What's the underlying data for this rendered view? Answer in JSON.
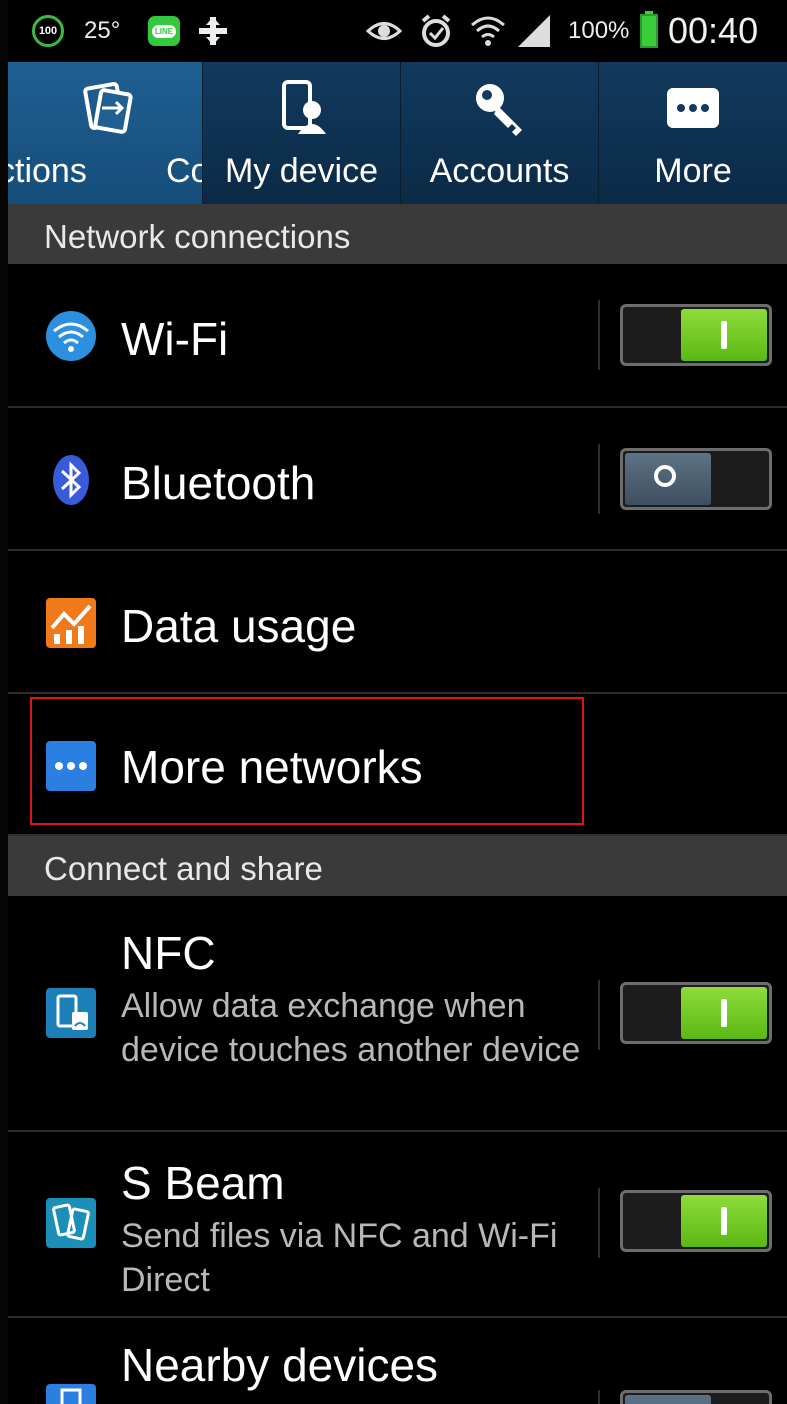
{
  "status_bar": {
    "battery_saver_badge": "100",
    "temperature": "25°",
    "line_app_label": "LINE",
    "battery_percent": "100%",
    "clock": "00:40"
  },
  "tabs": [
    {
      "label": "ctions",
      "icon": "connections-icon",
      "active": true
    },
    {
      "label": "Co",
      "icon": "",
      "active": false
    },
    {
      "label": "My device",
      "icon": "my-device-icon",
      "active": false
    },
    {
      "label": "Accounts",
      "icon": "accounts-key-icon",
      "active": false
    },
    {
      "label": "More",
      "icon": "more-dots-icon",
      "active": false
    }
  ],
  "sections": {
    "network": "Network connections",
    "connect_share": "Connect and share"
  },
  "rows": {
    "wifi": {
      "title": "Wi-Fi",
      "toggle": "on"
    },
    "bluetooth": {
      "title": "Bluetooth",
      "toggle": "off"
    },
    "data_usage": {
      "title": "Data usage"
    },
    "more_networks": {
      "title": "More networks",
      "highlighted": true
    },
    "nfc": {
      "title": "NFC",
      "subtitle": "Allow data exchange when device touches another device",
      "toggle": "on"
    },
    "s_beam": {
      "title": "S Beam",
      "subtitle": "Send files via NFC and Wi-Fi Direct",
      "toggle": "on"
    },
    "nearby_devices": {
      "title": "Nearby devices",
      "toggle": "off"
    }
  },
  "colors": {
    "tab_bg": "#0b2a46",
    "tab_active": "#1f5f92",
    "toggle_on": "#6cc423",
    "toggle_off": "#4e6274",
    "highlight": "#e01414",
    "section_bg": "#3a3a3a"
  }
}
